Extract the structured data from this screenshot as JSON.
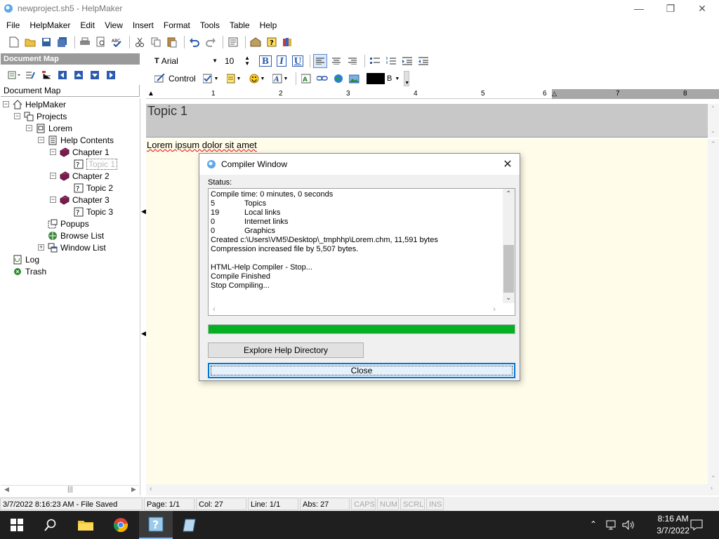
{
  "window": {
    "title": "newproject.sh5 - HelpMaker"
  },
  "menu": [
    "File",
    "HelpMaker",
    "Edit",
    "View",
    "Insert",
    "Format",
    "Tools",
    "Table",
    "Help"
  ],
  "left_panel": {
    "header": "Document Map",
    "label": "Document Map",
    "tree": [
      {
        "label": "HelpMaker",
        "icon": "home-icon",
        "expander": "−"
      },
      {
        "label": "Projects",
        "icon": "projects-icon",
        "expander": "−"
      },
      {
        "label": "Lorem",
        "icon": "project-icon",
        "expander": "−"
      },
      {
        "label": "Help Contents",
        "icon": "contents-icon",
        "expander": "−"
      },
      {
        "label": "Chapter 1",
        "icon": "book-icon",
        "expander": "−"
      },
      {
        "label": "Topic 1",
        "icon": "topic-icon",
        "selected": true
      },
      {
        "label": "Chapter 2",
        "icon": "book-icon",
        "expander": "−"
      },
      {
        "label": "Topic 2",
        "icon": "topic-icon"
      },
      {
        "label": "Chapter 3",
        "icon": "book-icon",
        "expander": "−"
      },
      {
        "label": "Topic 3",
        "icon": "topic-icon"
      },
      {
        "label": "Popups",
        "icon": "popups-icon"
      },
      {
        "label": "Browse List",
        "icon": "browse-icon"
      },
      {
        "label": "Window List",
        "icon": "window-list-icon",
        "expander": "+"
      },
      {
        "label": "Log",
        "icon": "log-icon"
      },
      {
        "label": "Trash",
        "icon": "trash-icon"
      }
    ]
  },
  "format_toolbar": {
    "font_name": "Arial",
    "font_size": "10",
    "control_label": "Control",
    "color_button_label": "B"
  },
  "ruler": {
    "numbers": [
      "1",
      "2",
      "3",
      "4",
      "5",
      "6",
      "7",
      "8"
    ]
  },
  "editor": {
    "topic_title": "Topic 1",
    "body_text": "Lorem ipsum dolor sit amet"
  },
  "dialog": {
    "title": "Compiler Window",
    "status_label": "Status:",
    "log_lines": [
      {
        "c1": "Compile time: 0 minutes, 0 seconds",
        "c2": ""
      },
      {
        "c1": "5",
        "c2": "Topics"
      },
      {
        "c1": "19",
        "c2": "Local links"
      },
      {
        "c1": "0",
        "c2": "Internet links"
      },
      {
        "c1": "0",
        "c2": "Graphics"
      },
      {
        "c1": "Created c:\\Users\\VM5\\Desktop\\_tmphhp\\Lorem.chm, 11,591 bytes",
        "c2": ""
      },
      {
        "c1": "Compression increased file by 5,507 bytes.",
        "c2": ""
      },
      {
        "c1": "",
        "c2": ""
      },
      {
        "c1": "HTML-Help Compiler - Stop...",
        "c2": ""
      },
      {
        "c1": "Compile Finished",
        "c2": ""
      },
      {
        "c1": "Stop Compiling...",
        "c2": ""
      }
    ],
    "progress": 1.0,
    "explore_button": "Explore Help Directory",
    "close_button": "Close"
  },
  "statusbar": {
    "message": "3/7/2022 8:16:23 AM - File Saved",
    "page": "Page: 1/1",
    "col": "Col: 27",
    "line": "Line: 1/1",
    "abs": "Abs: 27",
    "caps": "CAPS",
    "num": "NUM",
    "scrl": "SCRL",
    "ins": "INS"
  },
  "taskbar": {
    "time": "8:16 AM",
    "date": "3/7/2022"
  },
  "colors": {
    "progress": "#06b025",
    "accent": "#0078d7",
    "editor_bg": "#fffcea"
  }
}
